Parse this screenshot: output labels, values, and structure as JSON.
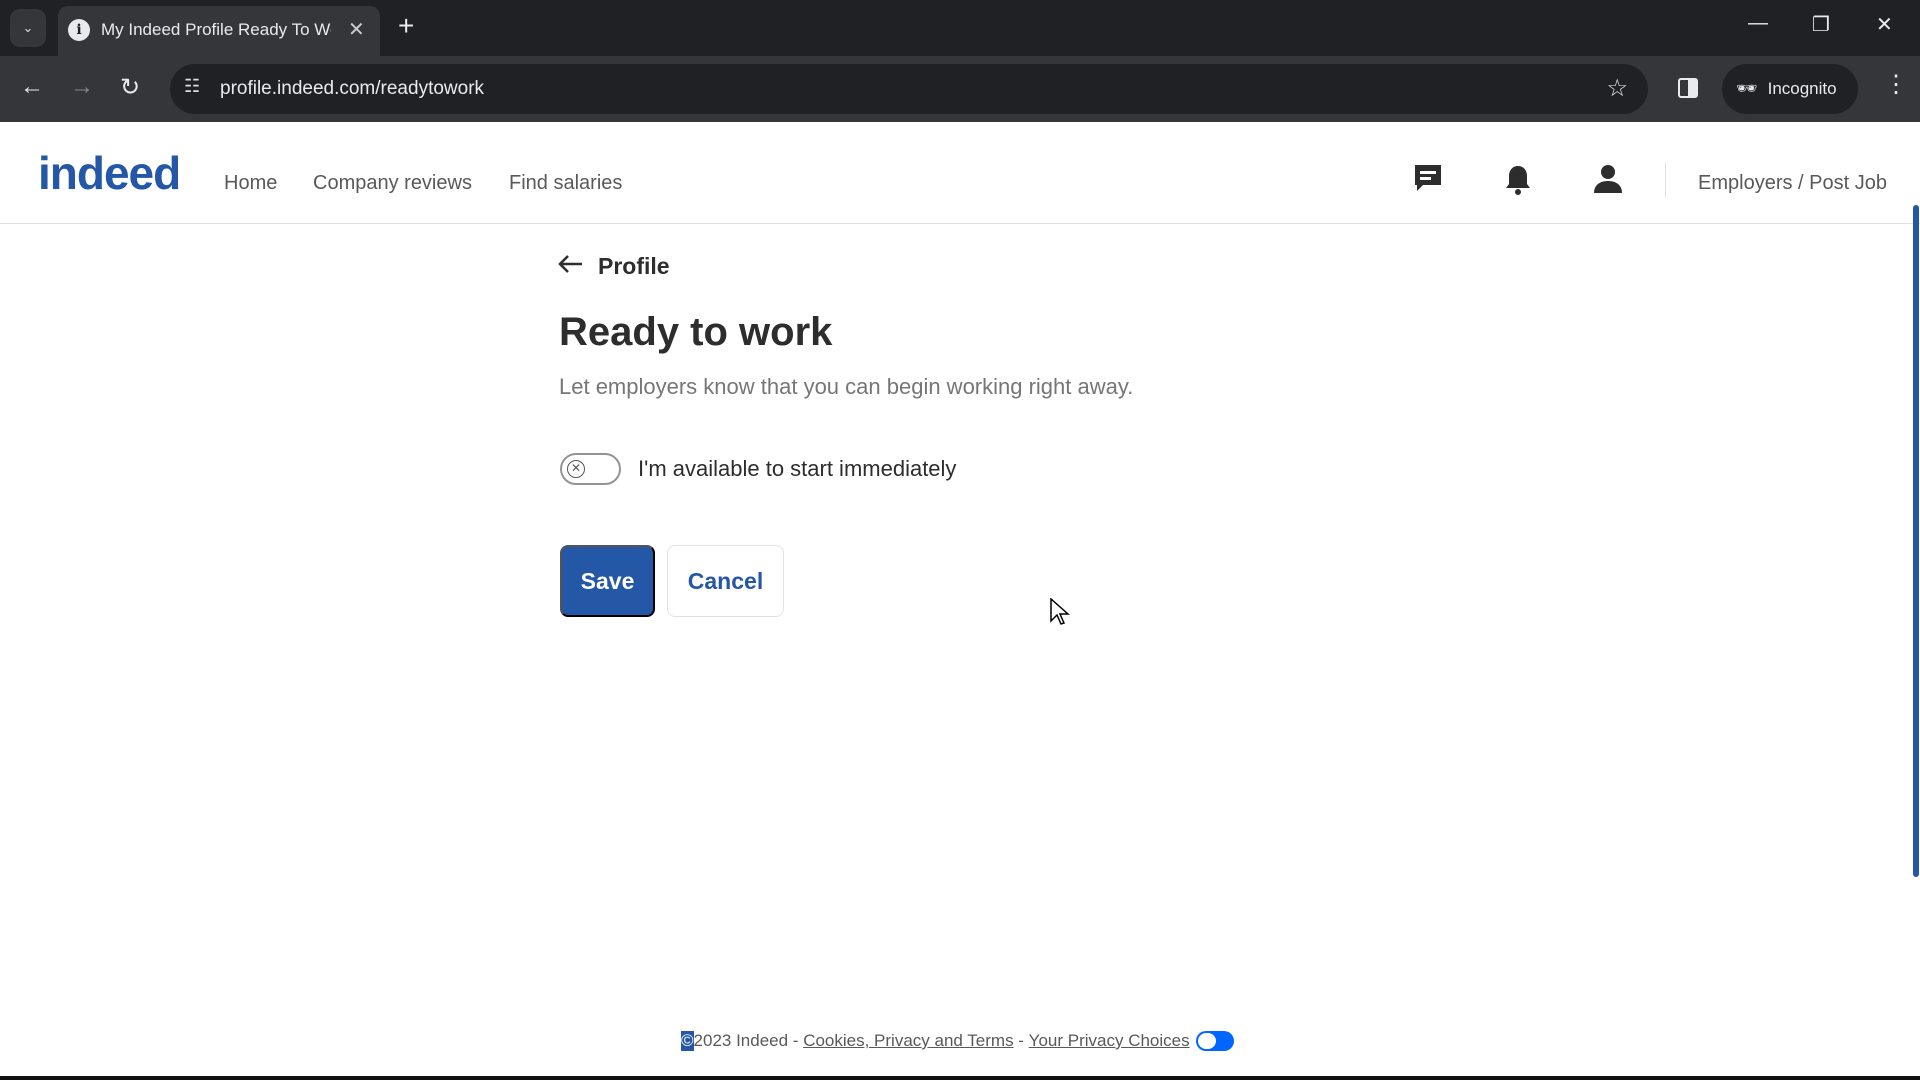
{
  "browser": {
    "tab_title": "My Indeed Profile Ready To Wo",
    "url": "profile.indeed.com/readytowork",
    "incognito_label": "Incognito"
  },
  "header": {
    "logo": "indeed",
    "nav": [
      "Home",
      "Company reviews",
      "Find salaries"
    ],
    "employers_link": "Employers / Post Job"
  },
  "main": {
    "back_label": "Profile",
    "title": "Ready to work",
    "subtitle": "Let employers know that you can begin working right away.",
    "toggle_label": "I'm available to start immediately",
    "toggle_on": false,
    "save_label": "Save",
    "cancel_label": "Cancel"
  },
  "footer": {
    "copyright": "©",
    "copyright_rest": "2023 Indeed - ",
    "cookies_link": "Cookies, Privacy and Terms",
    "sep": " - ",
    "privacy_choices_link": "Your Privacy Choices"
  },
  "colors": {
    "brand": "#2557a7"
  }
}
